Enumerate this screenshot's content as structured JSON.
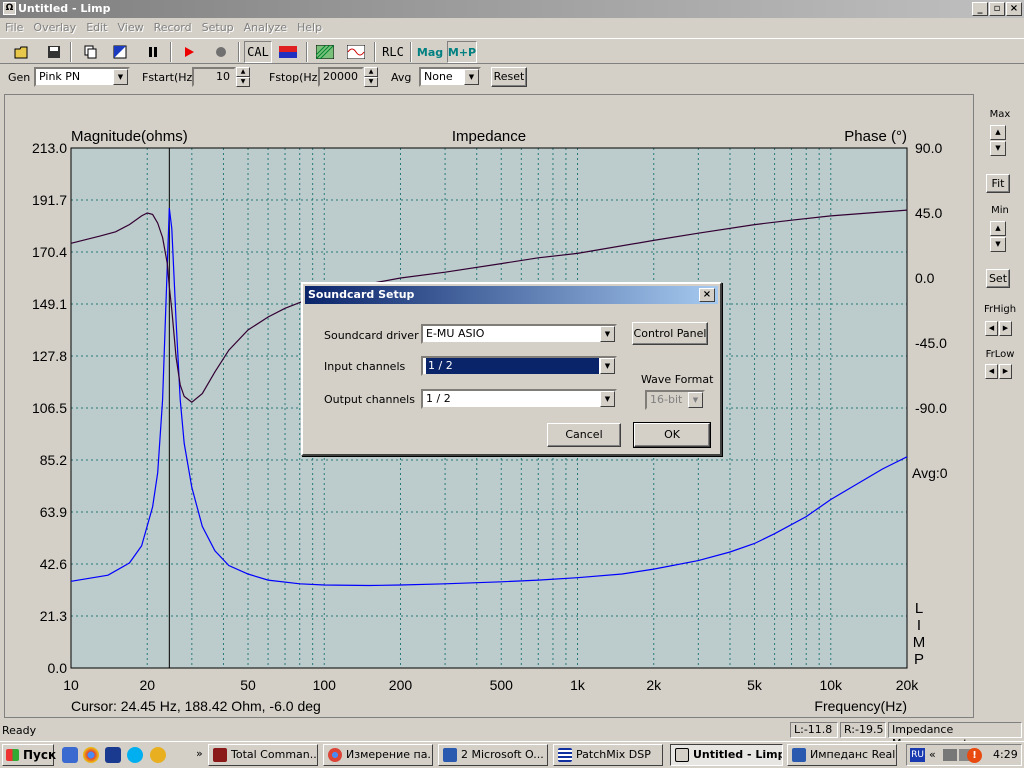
{
  "window": {
    "title": "Untitled - Limp"
  },
  "menu": [
    "File",
    "Overlay",
    "Edit",
    "View",
    "Record",
    "Setup",
    "Analyze",
    "Help"
  ],
  "toolbar": {
    "cal": "CAL",
    "rlc": "RLC",
    "mag": "Mag",
    "mp": "M+P"
  },
  "gen": {
    "gen_label": "Gen",
    "gen_value": "Pink PN",
    "fstart_label": "Fstart(Hz)",
    "fstart_value": "10",
    "fstop_label": "Fstop(Hz)",
    "fstop_value": "20000",
    "avg_label": "Avg",
    "avg_value": "None",
    "reset_label": "Reset"
  },
  "plot": {
    "left_axis_title": "Magnitude(ohms)",
    "center_title": "Impedance",
    "right_axis_title": "Phase (°)",
    "x_axis_title": "Frequency(Hz)",
    "cursor_text": "Cursor: 24.45 Hz, 188.42 Ohm, -6.0 deg",
    "avg_text": "Avg:0",
    "brand_vertical": [
      "L",
      "I",
      "M",
      "P"
    ],
    "bg_color": "#bccbcb",
    "mag_color": "#0000ff",
    "phase_color": "#330033"
  },
  "chart_data": {
    "type": "line",
    "title": "Impedance",
    "xlabel": "Frequency(Hz)",
    "ylabel": "Magnitude(ohms)",
    "y2label": "Phase (°)",
    "x_scale": "log",
    "xlim": [
      10,
      20000
    ],
    "ylim": [
      0,
      213
    ],
    "y2lim": [
      -270,
      90
    ],
    "x_ticks": [
      10,
      20,
      50,
      100,
      200,
      500,
      1000,
      2000,
      5000,
      10000,
      20000
    ],
    "x_tick_labels": [
      "10",
      "20",
      "50",
      "100",
      "200",
      "500",
      "1k",
      "2k",
      "5k",
      "10k",
      "20k"
    ],
    "y_ticks": [
      "0.0",
      "21.3",
      "42.6",
      "63.9",
      "85.2",
      "106.5",
      "127.8",
      "149.1",
      "170.4",
      "191.7",
      "213.0"
    ],
    "y2_ticks": [
      "90.0",
      "45.0",
      "0.0",
      "-45.0",
      "-90.0"
    ],
    "cursor_x": 24.45,
    "grid": true,
    "series": [
      {
        "axis": "left",
        "x": [
          10,
          14,
          17,
          19,
          21,
          22,
          23,
          24,
          24.45,
          25,
          26,
          27,
          28,
          30,
          33,
          37,
          42,
          50,
          60,
          80,
          100,
          150,
          200,
          300,
          500,
          700,
          1000,
          1500,
          2000,
          3000,
          4000,
          5000,
          6000,
          8000,
          10000,
          13000,
          16000,
          20000
        ],
        "values": [
          35.5,
          38,
          43,
          50,
          66,
          80,
          110,
          165,
          188.4,
          180,
          142,
          110,
          92,
          74,
          58,
          48,
          42,
          38.5,
          36,
          34.5,
          34,
          33.8,
          34,
          34.5,
          35.3,
          36,
          37,
          38.5,
          40.5,
          44,
          47.5,
          51,
          55,
          62,
          69,
          76,
          81.5,
          86.5
        ]
      },
      {
        "axis": "right",
        "x": [
          10,
          13,
          15,
          17,
          19,
          20,
          21,
          22,
          23,
          24,
          24.45,
          25,
          26,
          27,
          28,
          30,
          33,
          37,
          42,
          50,
          60,
          70,
          80,
          100,
          150,
          200,
          300,
          500,
          700,
          1000,
          2000,
          3000,
          5000,
          7000,
          10000,
          20000
        ],
        "values": [
          24,
          29,
          32,
          37,
          43,
          45,
          44,
          38,
          28,
          10,
          -6,
          -22,
          -55,
          -74,
          -82,
          -86,
          -80,
          -65,
          -50,
          -36,
          -27,
          -21,
          -17,
          -11,
          -4,
          0,
          4,
          10,
          14,
          17,
          26,
          31,
          37,
          40,
          43,
          47
        ]
      }
    ]
  },
  "panel": {
    "max": "Max",
    "fit": "Fit",
    "min": "Min",
    "set": "Set",
    "frhigh": "FrHigh",
    "frlow": "FrLow"
  },
  "status": {
    "ready": "Ready",
    "l": "L:-11.8",
    "r": "R:-19.5",
    "mode": "Impedance Measurement"
  },
  "dialog": {
    "title": "Soundcard Setup",
    "driver_label": "Soundcard driver",
    "driver_value": "E-MU ASIO",
    "input_label": "Input channels",
    "input_value": "1 / 2",
    "output_label": "Output channels",
    "output_value": "1 / 2",
    "control_panel": "Control Panel",
    "wave_format_label": "Wave Format",
    "wave_format_value": "16-bit",
    "cancel": "Cancel",
    "ok": "OK"
  },
  "taskbar": {
    "start": "Пуск",
    "tasks": [
      "Total Comman...",
      "Измерение па...",
      "2 Microsoft O...",
      "PatchMix DSP",
      "Untitled - Limp",
      "Импеданс Real..."
    ],
    "lang": "RU",
    "clock": "4:29"
  }
}
